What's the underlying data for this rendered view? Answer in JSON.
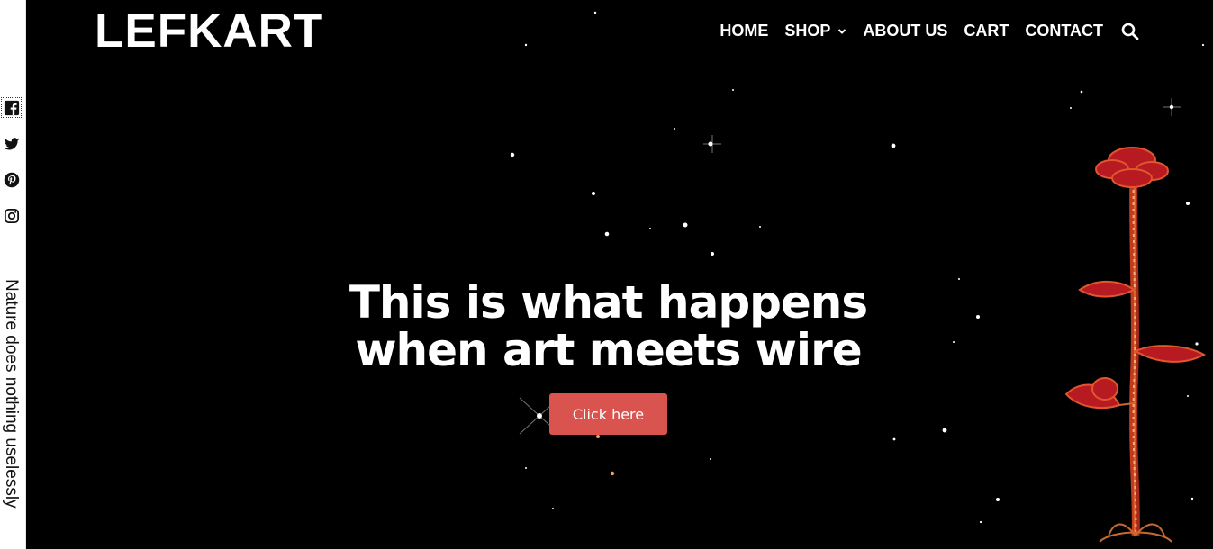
{
  "brand": {
    "logo": "LEFKART"
  },
  "nav": {
    "items": [
      {
        "label": "HOME"
      },
      {
        "label": "SHOP",
        "has_dropdown": true
      },
      {
        "label": "ABOUT US"
      },
      {
        "label": "CART"
      },
      {
        "label": "CONTACT"
      }
    ],
    "search_icon": "search-icon"
  },
  "social": {
    "items": [
      {
        "icon": "facebook-icon"
      },
      {
        "icon": "twitter-icon"
      },
      {
        "icon": "pinterest-icon"
      },
      {
        "icon": "instagram-icon"
      }
    ],
    "tagline": "Nature does nothing uselessly"
  },
  "hero": {
    "headline_line1": "This is what happens",
    "headline_line2": "when art meets wire",
    "cta_label": "Click here"
  },
  "colors": {
    "hero_background": "#000000",
    "cta_background": "#d9534f",
    "text_light": "#ffffff"
  }
}
